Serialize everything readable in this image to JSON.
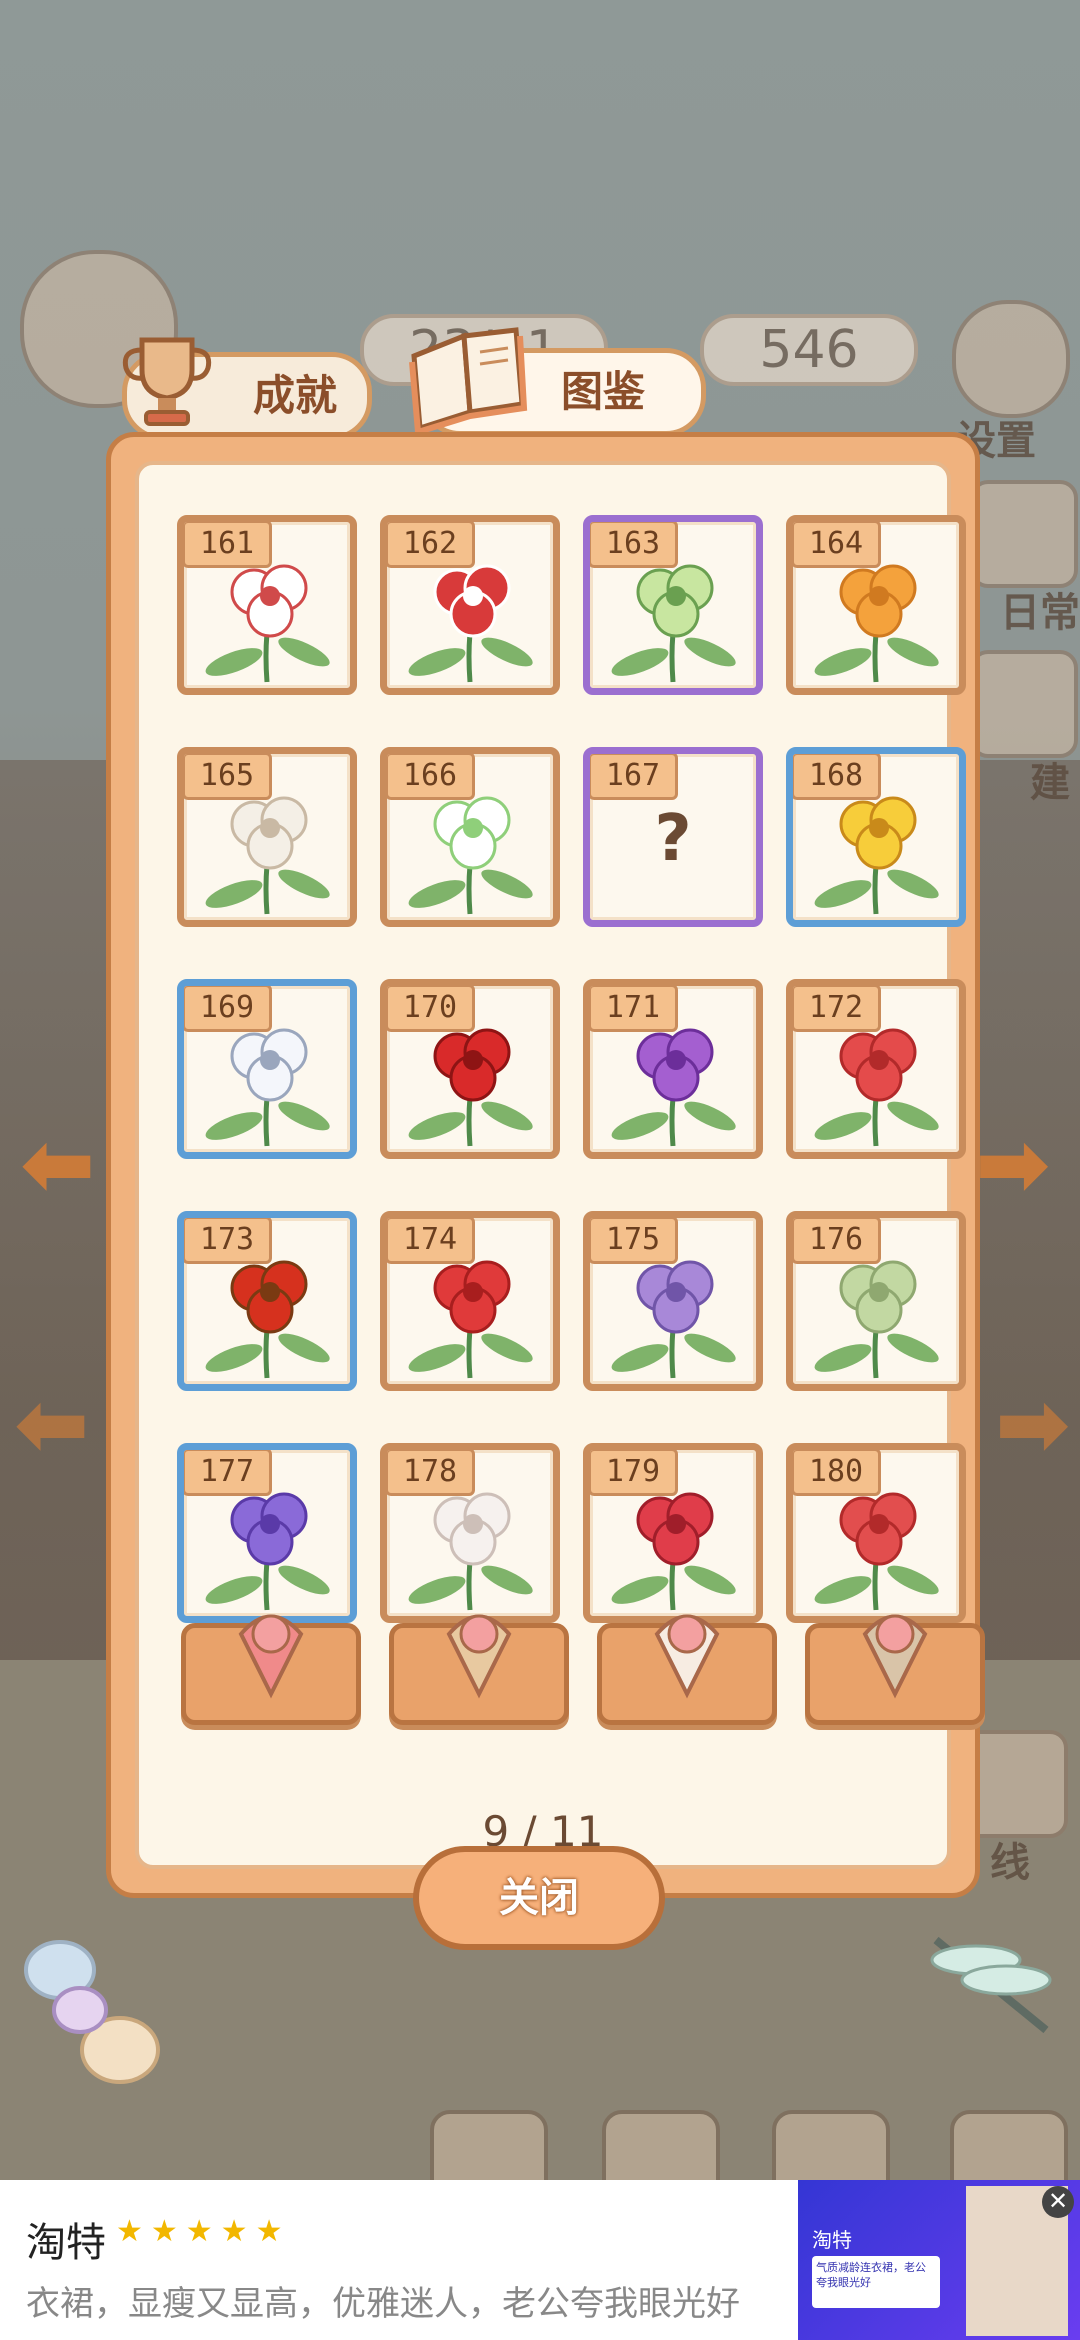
{
  "hud": {
    "fish_value": "23/11",
    "cheese_value": "546",
    "settings_label": "设置",
    "daily_label": "日常",
    "build_label": "建",
    "offline_label": "线"
  },
  "tabs": {
    "achievement": "成就",
    "catalog": "图鉴"
  },
  "cards": [
    {
      "num": "161",
      "frame": "orange",
      "flower": "hoya-white"
    },
    {
      "num": "162",
      "frame": "orange",
      "flower": "hoya-red"
    },
    {
      "num": "163",
      "frame": "purple",
      "flower": "rose-green"
    },
    {
      "num": "164",
      "frame": "orange",
      "flower": "orchid-orange"
    },
    {
      "num": "165",
      "frame": "orange",
      "flower": "bougainvillea-white"
    },
    {
      "num": "166",
      "frame": "orange",
      "flower": "vine-white"
    },
    {
      "num": "167",
      "frame": "purple",
      "flower": "unknown",
      "mark": "?"
    },
    {
      "num": "168",
      "frame": "blue",
      "flower": "spider-lily-yellow"
    },
    {
      "num": "169",
      "frame": "blue",
      "flower": "spider-lily-white"
    },
    {
      "num": "170",
      "frame": "orange",
      "flower": "tulip-red"
    },
    {
      "num": "171",
      "frame": "orange",
      "flower": "tulip-purple"
    },
    {
      "num": "172",
      "frame": "orange",
      "flower": "plumeria-red"
    },
    {
      "num": "173",
      "frame": "blue",
      "flower": "sunflower-red"
    },
    {
      "num": "174",
      "frame": "orange",
      "flower": "carnation-red"
    },
    {
      "num": "175",
      "frame": "orange",
      "flower": "carnation-purple"
    },
    {
      "num": "176",
      "frame": "orange",
      "flower": "carnation-green"
    },
    {
      "num": "177",
      "frame": "blue",
      "flower": "bellflower-purple"
    },
    {
      "num": "178",
      "frame": "orange",
      "flower": "camellia-white"
    },
    {
      "num": "179",
      "frame": "orange",
      "flower": "camellia-red"
    },
    {
      "num": "180",
      "frame": "orange",
      "flower": "fan-red"
    }
  ],
  "bouquets": [
    "rose-bouquet",
    "flower-bouquet",
    "paper-wrap",
    "photo-card"
  ],
  "pager": "9 / 11",
  "close_label": "关闭",
  "ad": {
    "title": "淘特",
    "stars": "★★★★★",
    "desc": "衣裙，显瘦又显高，优雅迷人，老公夸我眼光好",
    "img_brand": "淘特",
    "img_text": "气质减龄连衣裙，老公夸我眼光好",
    "close": "✕"
  },
  "colors": {
    "frame_orange": "#c98c5b",
    "frame_purple": "#9b6fd0",
    "frame_blue": "#5d9ed6",
    "panel": "#f0b27e"
  }
}
